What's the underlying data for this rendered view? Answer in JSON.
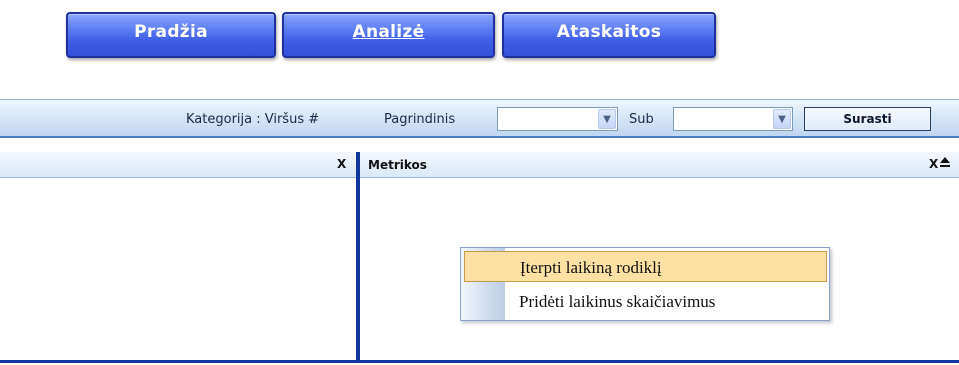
{
  "nav": {
    "tabs": [
      {
        "label": "Pradžia",
        "active": false
      },
      {
        "label": "Analizė",
        "active": true
      },
      {
        "label": "Ataskaitos",
        "active": false
      }
    ]
  },
  "filter_bar": {
    "category_label": "Kategorija : Viršus #",
    "main_label": "Pagrindinis",
    "main_value": "",
    "sub_label": "Sub",
    "sub_value": "",
    "search_button": "Surasti"
  },
  "left_panel": {
    "title": "",
    "close_label": "X"
  },
  "right_panel": {
    "title": "Metrikos",
    "close_label": "X",
    "collapse_icon": "eject-icon"
  },
  "context_menu": {
    "items": [
      {
        "label": "Įterpti laikiną rodiklį",
        "highlighted": true
      },
      {
        "label": "Pridėti laikinus skaičiavimus",
        "highlighted": false
      }
    ]
  },
  "colors": {
    "nav_tab": "#4466e8",
    "divider": "#12379a",
    "menu_highlight": "#fde0a4"
  }
}
